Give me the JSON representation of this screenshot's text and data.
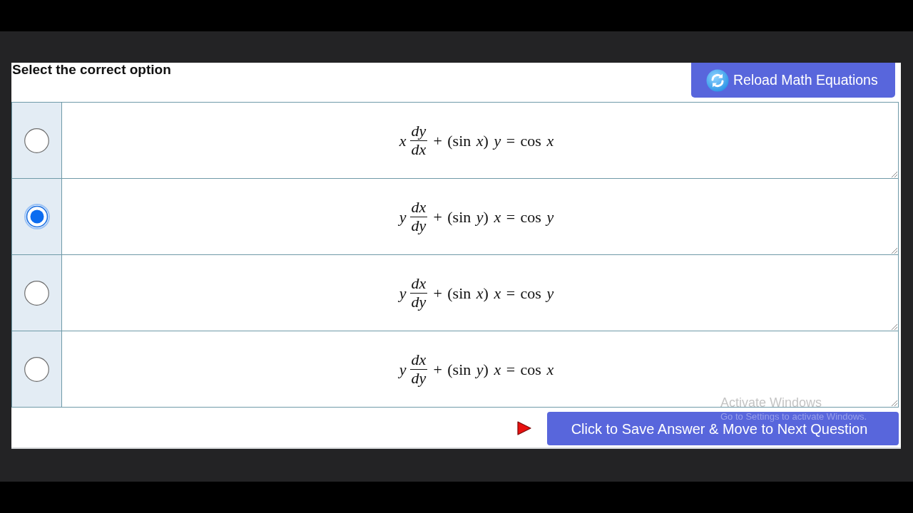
{
  "heading": "Select the correct option",
  "reload_button": {
    "label": "Reload Math Equations"
  },
  "options": [
    {
      "selected": false,
      "equation": {
        "lead": "x",
        "numerator": "dy",
        "denominator": "dx",
        "rest": "+ (sin *x*) *y* = cos *x*"
      }
    },
    {
      "selected": true,
      "equation": {
        "lead": "y",
        "numerator": "dx",
        "denominator": "dy",
        "rest": "+ (sin *y*) *x* = cos *y*"
      }
    },
    {
      "selected": false,
      "equation": {
        "lead": "y",
        "numerator": "dx",
        "denominator": "dy",
        "rest": "+ (sin *x*) *x* = cos *y*"
      }
    },
    {
      "selected": false,
      "equation": {
        "lead": "y",
        "numerator": "dx",
        "denominator": "dy",
        "rest": "+ (sin *y*) *x* = cos *x*"
      }
    }
  ],
  "save_button": {
    "label": "Click to Save Answer & Move to Next Question"
  },
  "os_notice": {
    "title": "Activate Windows",
    "subtitle": "Go to Settings to activate Windows."
  }
}
